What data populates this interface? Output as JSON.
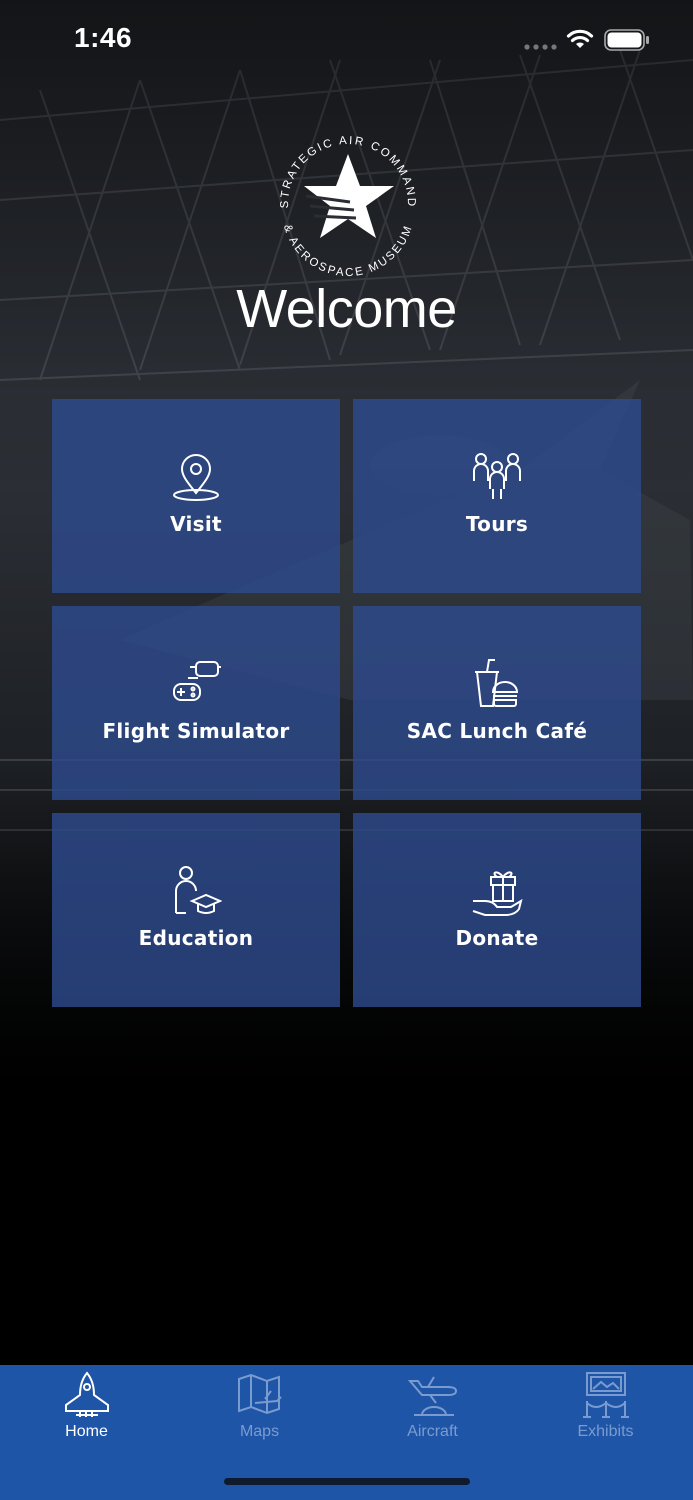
{
  "status_bar": {
    "time": "1:46",
    "icons": [
      "signal-dots-icon",
      "wifi-icon",
      "battery-icon"
    ]
  },
  "header": {
    "logo": {
      "icon": "sac-star-logo-icon",
      "ring_text_top": "STRATEGIC AIR COMMAND",
      "ring_text_bottom": "& AEROSPACE MUSEUM"
    },
    "title": "Welcome"
  },
  "tiles": [
    {
      "label": "Visit",
      "icon": "location-pin-icon"
    },
    {
      "label": "Tours",
      "icon": "group-people-icon"
    },
    {
      "label": "Flight Simulator",
      "icon": "vr-gamepad-icon"
    },
    {
      "label": "SAC Lunch Café",
      "icon": "drink-burger-icon"
    },
    {
      "label": "Education",
      "icon": "student-graduation-cap-icon"
    },
    {
      "label": "Donate",
      "icon": "gift-hand-icon"
    }
  ],
  "tabbar": {
    "items": [
      {
        "label": "Home",
        "icon": "space-shuttle-icon",
        "active": true
      },
      {
        "label": "Maps",
        "icon": "map-plane-icon",
        "active": false
      },
      {
        "label": "Aircraft",
        "icon": "aircraft-hangar-icon",
        "active": false
      },
      {
        "label": "Exhibits",
        "icon": "gallery-rope-icon",
        "active": false
      }
    ]
  },
  "colors": {
    "tile_bg": "#2d4a8c",
    "tabbar_bg": "#1f55a7",
    "tab_active": "#ffffff",
    "tab_inactive": "#7a9bd0"
  }
}
